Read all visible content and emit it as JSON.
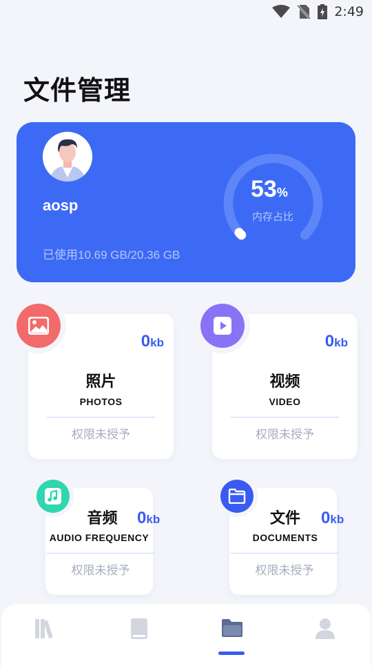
{
  "status_bar": {
    "time": "2:49",
    "icons": [
      "wifi-icon",
      "no-sim-icon",
      "battery-charging-icon"
    ]
  },
  "page": {
    "title": "文件管理"
  },
  "storage_card": {
    "username": "aosp",
    "usage_text": "已使用10.69 GB/20.36 GB",
    "percent": "53",
    "percent_sign": "%",
    "percent_value": 53,
    "percent_label": "内存占比",
    "colors": {
      "background": "#3d6af5",
      "gauge_track": "#5f86f8",
      "gauge_progress": "#ffffff"
    }
  },
  "categories": [
    {
      "title": "照片",
      "subtitle": "PHOTOS",
      "size": "0",
      "unit": "kb",
      "permission": "权限未授予",
      "icon": "image-icon",
      "color": "#f26a6a"
    },
    {
      "title": "视频",
      "subtitle": "VIDEO",
      "size": "0",
      "unit": "kb",
      "permission": "权限未授予",
      "icon": "play-icon",
      "color": "#8a72f6"
    },
    {
      "title": "音频",
      "subtitle": "AUDIO FREQUENCY",
      "size": "0",
      "unit": "kb",
      "permission": "权限未授予",
      "icon": "music-note-icon",
      "color": "#2fd6b0"
    },
    {
      "title": "文件",
      "subtitle": "DOCUMENTS",
      "size": "0",
      "unit": "kb",
      "permission": "权限未授予",
      "icon": "folder-icon",
      "color": "#3a5bf0"
    }
  ],
  "bottom_nav": {
    "items": [
      {
        "icon": "library-icon",
        "active": false
      },
      {
        "icon": "book-icon",
        "active": false
      },
      {
        "icon": "folder-icon",
        "active": true
      },
      {
        "icon": "person-icon",
        "active": false
      }
    ],
    "active_color": "#5b6b92",
    "inactive_color": "#d3d6de"
  }
}
